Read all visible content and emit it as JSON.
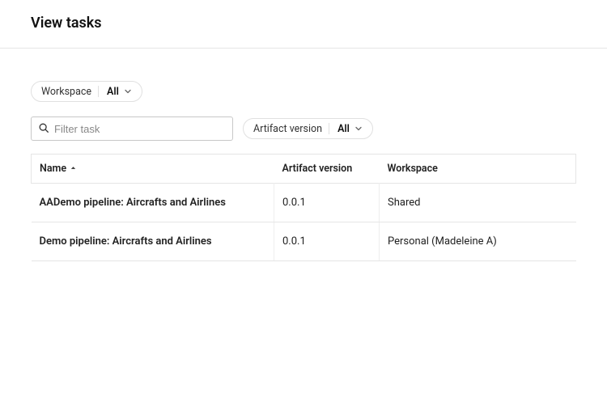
{
  "header": {
    "title": "View tasks"
  },
  "filters": {
    "workspace": {
      "label": "Workspace",
      "value": "All"
    },
    "artifact_version": {
      "label": "Artifact version",
      "value": "All"
    }
  },
  "search": {
    "placeholder": "Filter task",
    "value": ""
  },
  "table": {
    "columns": {
      "name": "Name",
      "artifact_version": "Artifact version",
      "workspace": "Workspace"
    },
    "sort": {
      "column": "name",
      "direction": "asc"
    },
    "rows": [
      {
        "name": "AADemo pipeline: Aircrafts and Airlines",
        "artifact_version": "0.0.1",
        "workspace": "Shared"
      },
      {
        "name": "Demo pipeline: Aircrafts and Airlines",
        "artifact_version": "0.0.1",
        "workspace": "Personal (Madeleine A)"
      }
    ]
  }
}
